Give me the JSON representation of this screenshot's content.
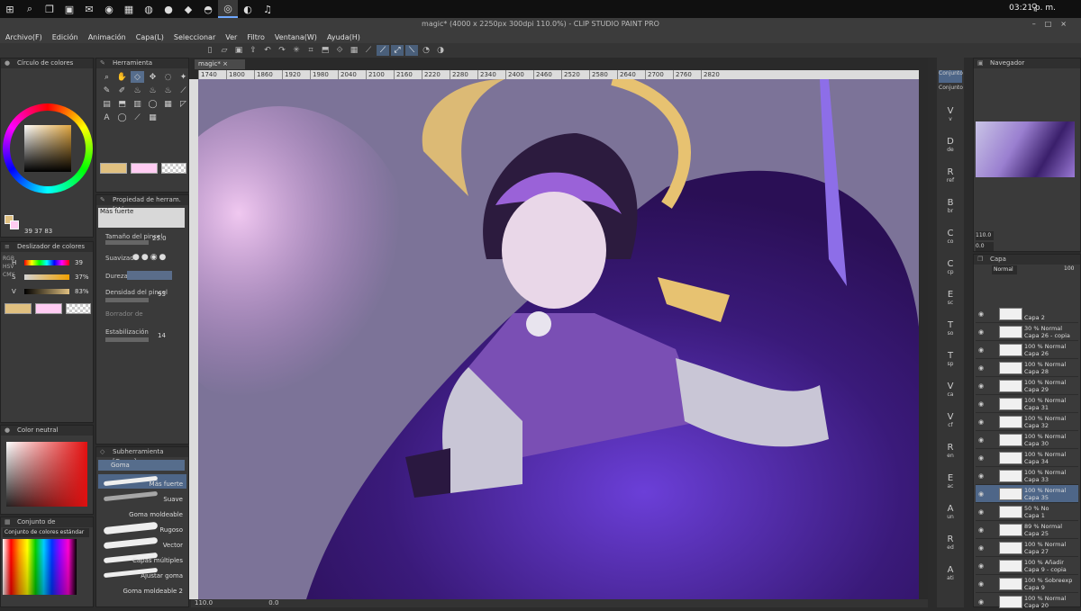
{
  "taskbar": {
    "icons": [
      "windows-icon",
      "search-icon",
      "task-view-icon",
      "store-icon",
      "mail-icon",
      "whatsapp-icon",
      "app-icon",
      "chrome-icon",
      "steam-icon",
      "spotify-icon"
    ],
    "clock": "03:21 p. m."
  },
  "window": {
    "title": "magic* (4000 x 2250px 300dpi 110.0%) - CLIP STUDIO PAINT PRO"
  },
  "menu": [
    "Archivo(F)",
    "Edición",
    "Animación",
    "Capa(L)",
    "Seleccionar",
    "Ver",
    "Filtro",
    "Ventana(W)",
    "Ayuda(H)"
  ],
  "color_wheel_panel": {
    "title": "Círculo de colores",
    "values": [
      "39",
      "37",
      "83"
    ]
  },
  "color_slider_panel": {
    "title": "Deslizador de colores",
    "rows": [
      {
        "label": "H",
        "value": "39"
      },
      {
        "label": "S",
        "value": "37%"
      },
      {
        "label": "V",
        "value": "83%"
      }
    ],
    "mode_tabs": [
      "RGB",
      "HSV",
      "CMY"
    ]
  },
  "neutral_panel": {
    "title": "Color neutral"
  },
  "colorset_panel": {
    "title": "Conjunto de",
    "dropdown": "Conjunto de colores estándar"
  },
  "tool_panel": {
    "title": "Herramienta"
  },
  "tool_property": {
    "title": "Propiedad de herram. [Más",
    "preset": "Más fuerte",
    "brush_size_label": "Tamaño del pincel",
    "brush_size": "25.0",
    "smoothing_label": "Suavizado",
    "hardness_label": "Dureza",
    "density_label": "Densidad del pincel",
    "density": "93",
    "border_label": "Borrador de",
    "stabilization_label": "Estabilización",
    "stabilization": "14"
  },
  "subtool_panel": {
    "title": "Subherramienta [Goma]",
    "group": "Goma",
    "items": [
      "Más fuerte",
      "Suave",
      "Goma moldeable",
      "Rugoso",
      "Vector",
      "Capas múltiples",
      "Ajustar goma",
      "Goma moldeable 2"
    ]
  },
  "canvas": {
    "tab": "magic*",
    "ruler_ticks": [
      "1740",
      "1800",
      "1860",
      "1920",
      "1980",
      "2040",
      "2100",
      "2160",
      "2220",
      "2280",
      "2340",
      "2400",
      "2460",
      "2520",
      "2580",
      "2640",
      "2700",
      "2760",
      "2820"
    ],
    "zoom": "110.0",
    "angle": "0.0"
  },
  "right_tools": {
    "tabs": [
      "Conjunto",
      "Conjunto"
    ],
    "items": [
      {
        "key": "V",
        "sub": "v"
      },
      {
        "key": "D",
        "sub": "de"
      },
      {
        "key": "R",
        "sub": "ref"
      },
      {
        "key": "B",
        "sub": "br"
      },
      {
        "key": "C",
        "sub": "co"
      },
      {
        "key": "C",
        "sub": "cp"
      },
      {
        "key": "E",
        "sub": "sc"
      },
      {
        "key": "T",
        "sub": "so"
      },
      {
        "key": "T",
        "sub": "sp"
      },
      {
        "key": "V",
        "sub": "ca"
      },
      {
        "key": "V",
        "sub": "cf"
      },
      {
        "key": "R",
        "sub": "en"
      },
      {
        "key": "E",
        "sub": "ac"
      },
      {
        "key": "A",
        "sub": "un"
      },
      {
        "key": "R",
        "sub": "ed"
      },
      {
        "key": "A",
        "sub": "ati"
      }
    ]
  },
  "navigator": {
    "title": "Navegador",
    "zoom": "110.0",
    "angle": "0.0"
  },
  "layers": {
    "title": "Capa",
    "blend": "Normal",
    "opacity": "100",
    "items": [
      {
        "op": "",
        "name": "Capa 2"
      },
      {
        "op": "30 % Normal",
        "name": "Capa 26 - copia"
      },
      {
        "op": "100 % Normal",
        "name": "Capa 26"
      },
      {
        "op": "100 % Normal",
        "name": "Capa 28"
      },
      {
        "op": "100 % Normal",
        "name": "Capa 29"
      },
      {
        "op": "100 % Normal",
        "name": "Capa 31"
      },
      {
        "op": "100 % Normal",
        "name": "Capa 32"
      },
      {
        "op": "100 % Normal",
        "name": "Capa 30"
      },
      {
        "op": "100 % Normal",
        "name": "Capa 34"
      },
      {
        "op": "100 % Normal",
        "name": "Capa 33"
      },
      {
        "op": "100 % Normal",
        "name": "Capa 35"
      },
      {
        "op": "50 % No",
        "name": "Capa 1"
      },
      {
        "op": "89 % Normal",
        "name": "Capa 25"
      },
      {
        "op": "100 % Normal",
        "name": "Capa 27"
      },
      {
        "op": "100 % Añadir",
        "name": "Capa 9 - copia"
      },
      {
        "op": "100 % Sobreexp",
        "name": "Capa 9"
      },
      {
        "op": "100 % Normal",
        "name": "Capa 20"
      }
    ],
    "selected_index": 10
  },
  "colors": {
    "main": "#e0c080",
    "sub": "#ffccf2",
    "accent": "#4e6688"
  }
}
